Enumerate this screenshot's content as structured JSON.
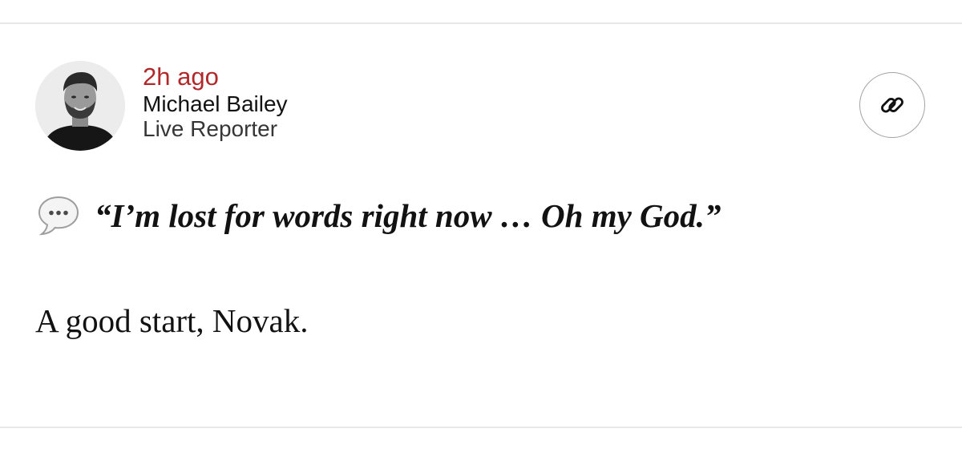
{
  "post": {
    "timestamp": "2h ago",
    "author": {
      "name": "Michael Bailey",
      "role": "Live Reporter",
      "avatar": "author-photo"
    },
    "actions": {
      "copy_link_icon": "link-icon"
    },
    "quote": {
      "icon": "speech-bubble-icon",
      "text": "“I’m lost for words right now … Oh my God.”"
    },
    "body": "A good start, Novak."
  },
  "colors": {
    "timestamp": "#b2282a",
    "text": "#121212",
    "secondary_text": "#363636",
    "divider": "#e8e8e8",
    "button_border": "#a3a3a3"
  }
}
